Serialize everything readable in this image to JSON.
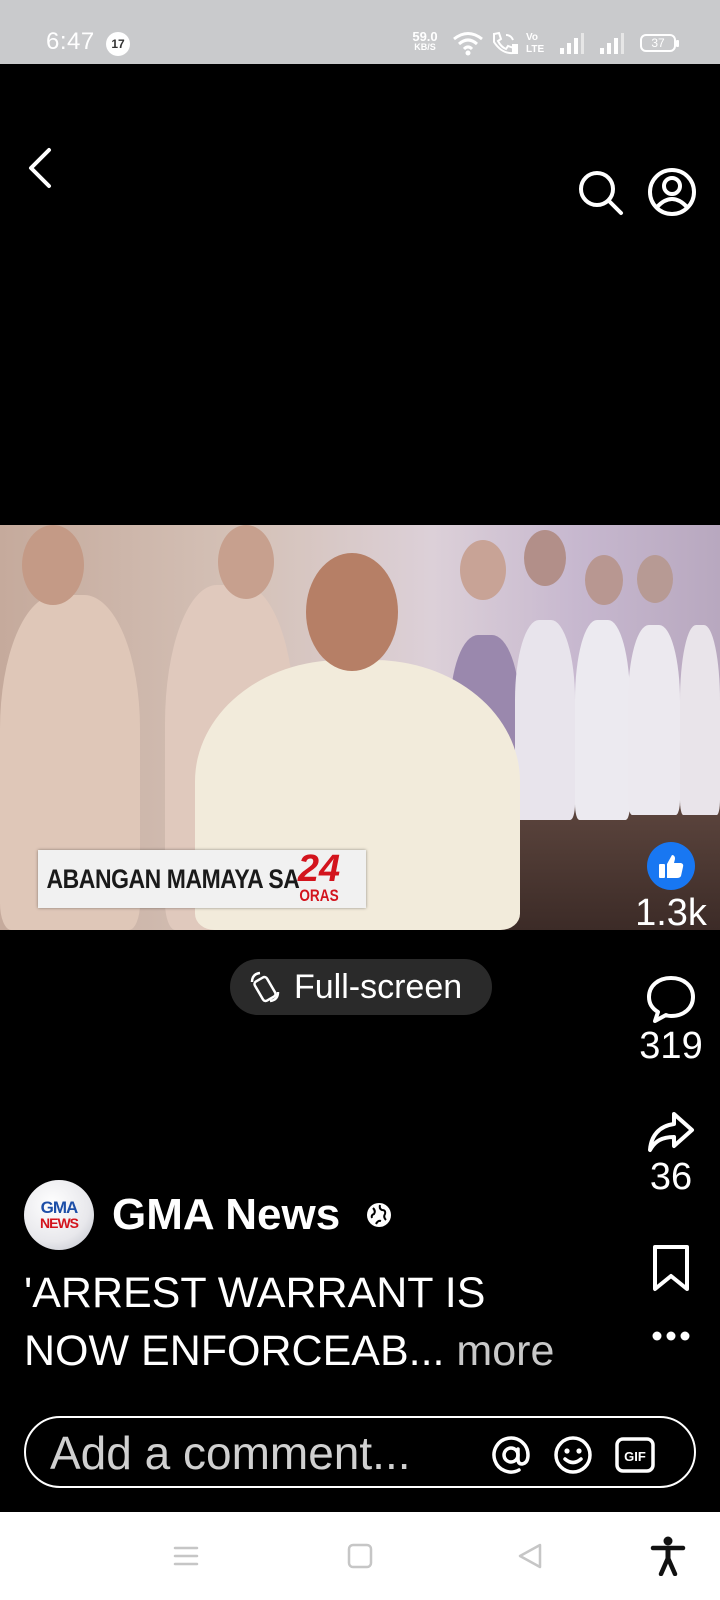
{
  "status_bar": {
    "time": "6:47",
    "notification_count": "17",
    "net_speed_value": "59.0",
    "net_speed_unit": "KB/S",
    "battery": "37",
    "icons": [
      "wifi-icon",
      "wifi-calling-icon",
      "volte-icon",
      "signal-icon",
      "signal-icon",
      "battery-icon"
    ]
  },
  "top_nav": {
    "icons": [
      "back-arrow-icon",
      "search-icon",
      "profile-icon"
    ]
  },
  "video": {
    "overlay_text": "ABANGAN MAMAYA SA",
    "logo_number": "24",
    "logo_text": "ORAS"
  },
  "fullscreen": {
    "label": "Full-screen",
    "icon": "rotate-screen-icon"
  },
  "actions": {
    "likes": "1.3k",
    "comments": "319",
    "shares": "36",
    "icons": [
      "like-icon",
      "comment-icon",
      "share-icon",
      "bookmark-icon",
      "more-icon"
    ]
  },
  "author": {
    "name": "GMA News",
    "avatar_line1": "GMA",
    "avatar_line2": "NEWS",
    "visibility_icon": "globe-icon"
  },
  "caption": {
    "text": "'ARREST WARRANT IS NOW ENFORCEAB...",
    "more_label": "more"
  },
  "comment_bar": {
    "placeholder": "Add a comment...",
    "icons": [
      "mention-icon",
      "emoji-icon",
      "gif-icon"
    ]
  },
  "nav_bar": {
    "icons": [
      "menu-icon",
      "home-icon",
      "back-icon",
      "accessibility-icon"
    ]
  }
}
